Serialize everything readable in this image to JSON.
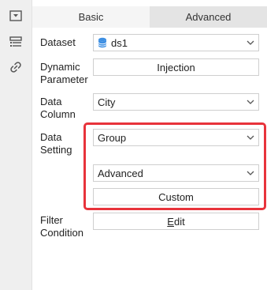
{
  "tabs": {
    "basic": "Basic",
    "advanced": "Advanced"
  },
  "rail": {
    "icons": [
      "dropdown-panel-icon",
      "list-layers-icon",
      "link-icon"
    ]
  },
  "form": {
    "dataset": {
      "label": "Dataset",
      "value": "ds1"
    },
    "dynamic_parameter": {
      "label_line1": "Dynamic",
      "label_line2": "Parameter",
      "button": "Injection"
    },
    "data_column": {
      "label_line1": "Data",
      "label_line2": "Column",
      "value": "City"
    },
    "data_setting": {
      "label_line1": "Data",
      "label_line2": "Setting",
      "group_value": "Group",
      "mode_value": "Advanced",
      "custom_button": "Custom"
    },
    "filter_condition": {
      "label_line1": "Filter",
      "label_line2": "Condition",
      "edit_first": "E",
      "edit_rest": "dit"
    }
  },
  "colors": {
    "highlight": "#e8333b",
    "dataset_icon": "#3d8fe3"
  }
}
